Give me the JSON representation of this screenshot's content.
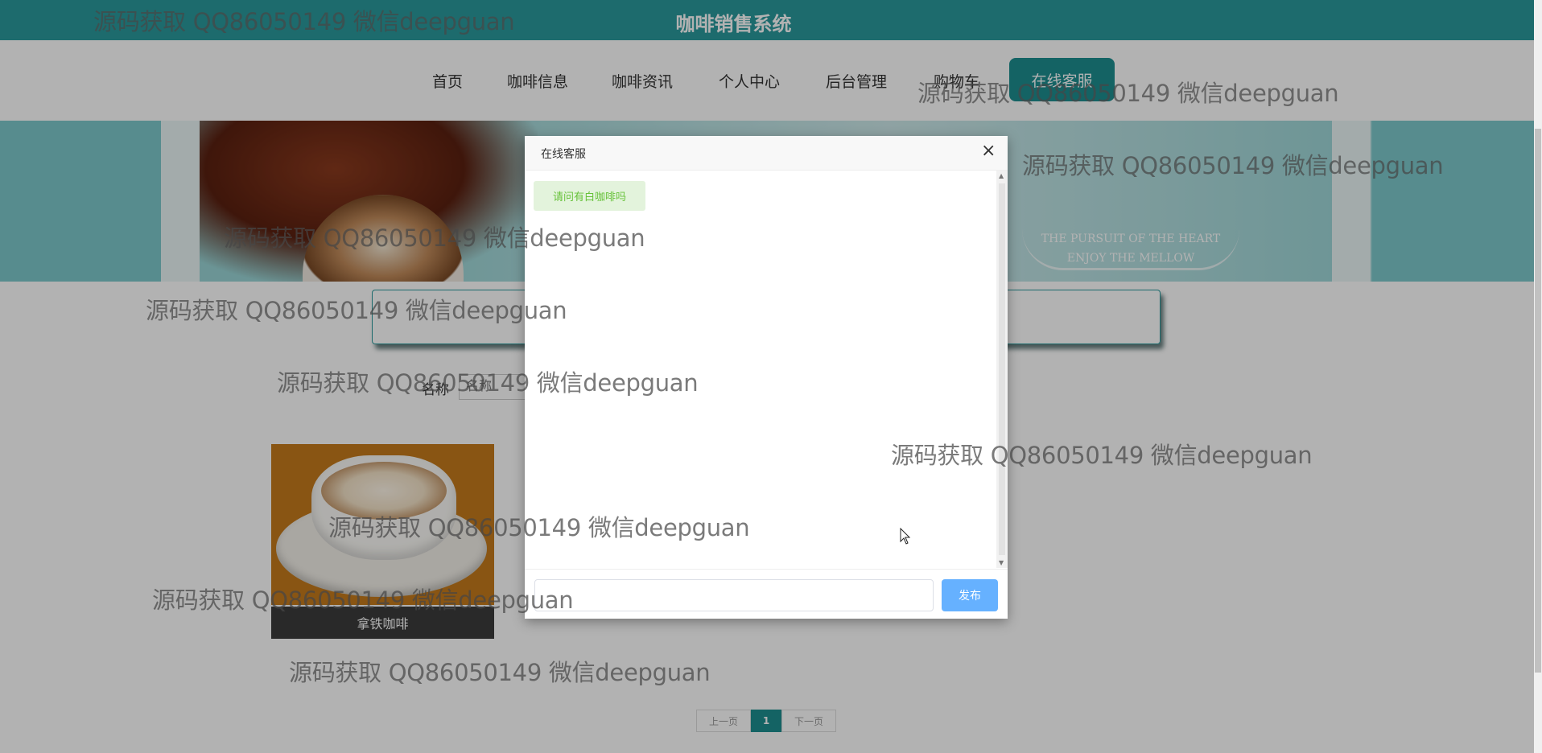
{
  "header": {
    "title": "咖啡销售系统"
  },
  "nav": {
    "home": "首页",
    "coffee_info": "咖啡信息",
    "coffee_news": "咖啡资讯",
    "personal_center": "个人中心",
    "admin": "后台管理",
    "cart": "购物车",
    "online_service": "在线客服"
  },
  "banner": {
    "line1": "THE PURSUIT OF THE HEART",
    "line2": "ENJOY THE MELLOW"
  },
  "filter": {
    "label": "名称",
    "placeholder": "名称"
  },
  "products": [
    {
      "name": "拿铁咖啡"
    }
  ],
  "pagination": {
    "prev": "上一页",
    "current": "1",
    "next": "下一页"
  },
  "dialog": {
    "title": "在线客服",
    "close_icon": "×",
    "messages": [
      {
        "text": "请问有白咖啡吗"
      }
    ],
    "input_value": "",
    "send_label": "发布"
  },
  "watermark": {
    "text": "源码获取 QQ86050149 微信deepguan"
  },
  "colors": {
    "primary": "#2a9a9c",
    "nav_active": "#1d8e90",
    "send_button": "#66b1ff",
    "bubble_text": "#67c23a"
  }
}
